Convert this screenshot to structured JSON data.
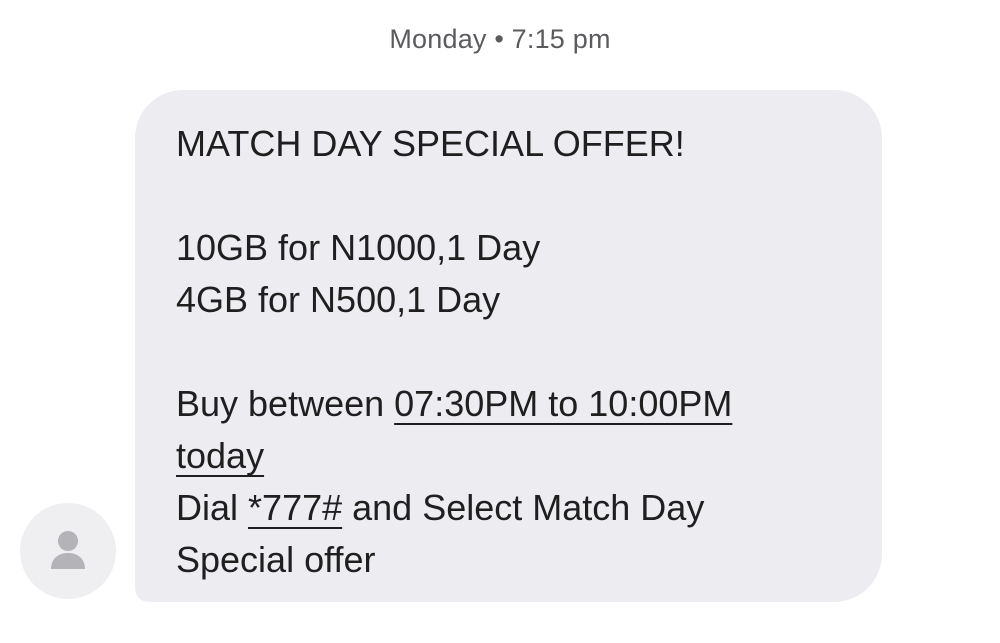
{
  "conversation": {
    "timestamp": "Monday • 7:15 pm"
  },
  "message": {
    "heading": "MATCH DAY SPECIAL OFFER!",
    "offers": [
      "10GB for N1000,1 Day",
      "4GB for N500,1 Day"
    ],
    "buy_prefix": "Buy between ",
    "buy_time_link": "07:30PM to 10:00PM",
    "buy_today_link": "today",
    "dial_prefix": "Dial ",
    "dial_code_link": "*777#",
    "dial_suffix": " and Select Match Day",
    "dial_suffix_cont": "Special offer"
  },
  "sender": {
    "avatar_icon": "person-icon"
  },
  "colors": {
    "bubble": "#ececf1",
    "avatar_bg": "#efeff2",
    "avatar_fg": "#b3b3b8",
    "text": "#1f1f1f",
    "timestamp": "#5b5b5f"
  }
}
